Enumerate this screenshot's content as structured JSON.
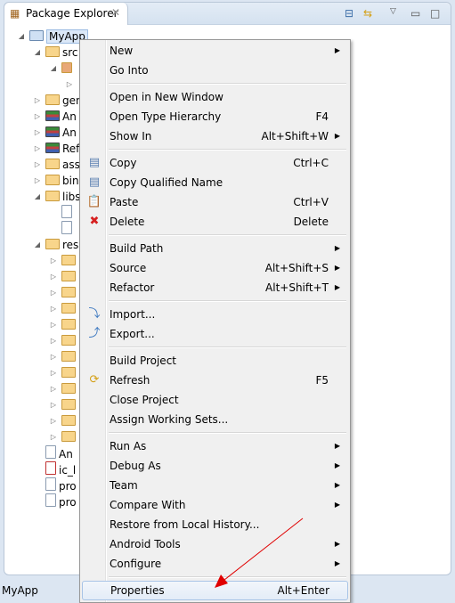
{
  "view": {
    "title": "Package Explorer",
    "toolbar": [
      "collapse-all-icon",
      "link-with-editor-icon",
      "view-menu-icon",
      "minimize-icon",
      "maximize-icon"
    ]
  },
  "tree": [
    {
      "label": "MyApp",
      "level": 0,
      "tw": "open",
      "icon": "project-icon",
      "selected": true
    },
    {
      "label": "src",
      "level": 1,
      "tw": "open",
      "icon": "source-folder-icon"
    },
    {
      "label": "",
      "level": 2,
      "tw": "open",
      "icon": "package-icon"
    },
    {
      "label": "",
      "level": 3,
      "tw": "closed",
      "icon": ""
    },
    {
      "label": "gen",
      "level": 1,
      "tw": "closed",
      "icon": "source-folder-icon"
    },
    {
      "label": "An",
      "level": 1,
      "tw": "closed",
      "icon": "library-icon"
    },
    {
      "label": "An",
      "level": 1,
      "tw": "closed",
      "icon": "library-icon"
    },
    {
      "label": "Ref",
      "level": 1,
      "tw": "closed",
      "icon": "library-icon"
    },
    {
      "label": "ass",
      "level": 1,
      "tw": "closed",
      "icon": "folder-icon"
    },
    {
      "label": "bin",
      "level": 1,
      "tw": "closed",
      "icon": "folder-icon"
    },
    {
      "label": "libs",
      "level": 1,
      "tw": "open",
      "icon": "folder-icon"
    },
    {
      "label": "",
      "level": 2,
      "tw": "",
      "icon": "jar-icon"
    },
    {
      "label": "",
      "level": 2,
      "tw": "",
      "icon": "jar-icon"
    },
    {
      "label": "res",
      "level": 1,
      "tw": "open",
      "icon": "folder-icon"
    },
    {
      "label": "",
      "level": 2,
      "tw": "closed",
      "icon": "folder-icon"
    },
    {
      "label": "",
      "level": 2,
      "tw": "closed",
      "icon": "folder-icon"
    },
    {
      "label": "",
      "level": 2,
      "tw": "closed",
      "icon": "folder-icon"
    },
    {
      "label": "",
      "level": 2,
      "tw": "closed",
      "icon": "folder-icon"
    },
    {
      "label": "",
      "level": 2,
      "tw": "closed",
      "icon": "folder-icon"
    },
    {
      "label": "",
      "level": 2,
      "tw": "closed",
      "icon": "folder-icon"
    },
    {
      "label": "",
      "level": 2,
      "tw": "closed",
      "icon": "folder-icon"
    },
    {
      "label": "",
      "level": 2,
      "tw": "closed",
      "icon": "folder-icon"
    },
    {
      "label": "",
      "level": 2,
      "tw": "closed",
      "icon": "folder-icon"
    },
    {
      "label": "",
      "level": 2,
      "tw": "closed",
      "icon": "folder-icon"
    },
    {
      "label": "",
      "level": 2,
      "tw": "closed",
      "icon": "folder-icon"
    },
    {
      "label": "",
      "level": 2,
      "tw": "closed",
      "icon": "folder-icon"
    },
    {
      "label": "An",
      "level": 1,
      "tw": "",
      "icon": "manifest-icon"
    },
    {
      "label": "ic_l",
      "level": 1,
      "tw": "",
      "icon": "image-file-icon"
    },
    {
      "label": "pro",
      "level": 1,
      "tw": "",
      "icon": "file-icon"
    },
    {
      "label": "pro",
      "level": 1,
      "tw": "",
      "icon": "file-icon"
    }
  ],
  "menu": [
    [
      {
        "label": "New",
        "submenu": true
      },
      {
        "label": "Go Into"
      }
    ],
    [
      {
        "label": "Open in New Window"
      },
      {
        "label": "Open Type Hierarchy",
        "shortcut": "F4"
      },
      {
        "label": "Show In",
        "shortcut": "Alt+Shift+W",
        "submenu": true
      }
    ],
    [
      {
        "label": "Copy",
        "shortcut": "Ctrl+C",
        "icon": "copy-icon"
      },
      {
        "label": "Copy Qualified Name",
        "icon": "copy-qualified-icon"
      },
      {
        "label": "Paste",
        "shortcut": "Ctrl+V",
        "icon": "paste-icon"
      },
      {
        "label": "Delete",
        "shortcut": "Delete",
        "icon": "delete-icon"
      }
    ],
    [
      {
        "label": "Build Path",
        "submenu": true
      },
      {
        "label": "Source",
        "shortcut": "Alt+Shift+S",
        "submenu": true
      },
      {
        "label": "Refactor",
        "shortcut": "Alt+Shift+T",
        "submenu": true
      }
    ],
    [
      {
        "label": "Import...",
        "icon": "import-icon"
      },
      {
        "label": "Export...",
        "icon": "export-icon"
      }
    ],
    [
      {
        "label": "Build Project"
      },
      {
        "label": "Refresh",
        "shortcut": "F5",
        "icon": "refresh-icon"
      },
      {
        "label": "Close Project"
      },
      {
        "label": "Assign Working Sets..."
      }
    ],
    [
      {
        "label": "Run As",
        "submenu": true
      },
      {
        "label": "Debug As",
        "submenu": true
      },
      {
        "label": "Team",
        "submenu": true
      },
      {
        "label": "Compare With",
        "submenu": true
      },
      {
        "label": "Restore from Local History..."
      },
      {
        "label": "Android Tools",
        "submenu": true
      },
      {
        "label": "Configure",
        "submenu": true
      }
    ],
    [
      {
        "label": "Properties",
        "shortcut": "Alt+Enter",
        "highlighted": true
      }
    ]
  ],
  "status": "MyApp",
  "annotation_color": "#e00000"
}
